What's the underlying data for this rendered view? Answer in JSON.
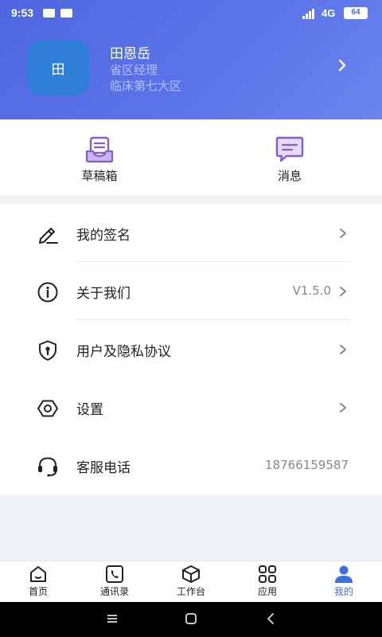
{
  "status_bar": {
    "time": "9:53",
    "network": "4G",
    "battery": "64"
  },
  "profile": {
    "avatar_text": "田",
    "name": "田恩岳",
    "role": "省区经理",
    "region": "临床第七大区"
  },
  "quick_actions": [
    {
      "label": "草稿箱",
      "icon": "drafts-icon"
    },
    {
      "label": "消息",
      "icon": "message-icon"
    }
  ],
  "menu": [
    {
      "label": "我的签名",
      "value": "",
      "icon": "pen-signature-icon"
    },
    {
      "label": "关于我们",
      "value": "V1.5.0",
      "icon": "info-icon"
    },
    {
      "label": "用户及隐私协议",
      "value": "",
      "icon": "shield-lock-icon"
    },
    {
      "label": "设置",
      "value": "",
      "icon": "settings-hexagon-icon"
    },
    {
      "label": "客服电话",
      "value": "18766159587",
      "icon": "headset-icon"
    }
  ],
  "tabs": [
    {
      "label": "首页",
      "icon": "home-icon"
    },
    {
      "label": "通讯录",
      "icon": "contacts-phone-icon"
    },
    {
      "label": "工作台",
      "icon": "workbench-box-icon"
    },
    {
      "label": "应用",
      "icon": "apps-grid-icon"
    },
    {
      "label": "我的",
      "icon": "user-icon",
      "active": true
    }
  ],
  "colors": {
    "header": "#5069e2",
    "accent": "#3d6fe0",
    "quick_icon": "#8a5cc9"
  }
}
